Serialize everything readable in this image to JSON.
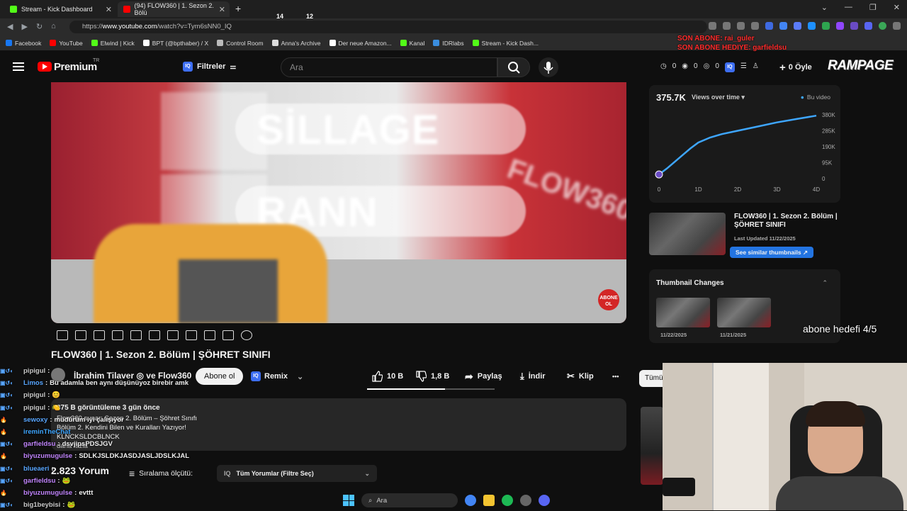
{
  "browser": {
    "tabs": [
      {
        "title": "Stream - Kick Dashboard",
        "color": "#53fc18"
      },
      {
        "title": "(94) FLOW360 | 1. Sezon 2. Bölü",
        "color": "#ff0000"
      }
    ],
    "trophies": [
      "14",
      "12"
    ],
    "url_prefix": "https://",
    "url_domain": "www.youtube.com",
    "url_path": "/watch?v=Tym6sNN0_IQ",
    "bookmarks": [
      {
        "label": "Facebook",
        "color": "#1877f2"
      },
      {
        "label": "YouTube",
        "color": "#ff0000"
      },
      {
        "label": "Elwind | Kick",
        "color": "#53fc18"
      },
      {
        "label": "BPT (@bpthaber) / X",
        "color": "#ffffff"
      },
      {
        "label": "Control Room",
        "color": "#bbbbbb"
      },
      {
        "label": "Anna's Archive",
        "color": "#dddddd"
      },
      {
        "label": "Der neue Amazon...",
        "color": "#ffffff"
      },
      {
        "label": "Kanal",
        "color": "#53fc18"
      },
      {
        "label": "IDRlabs",
        "color": "#3a8dde"
      },
      {
        "label": "Stream - Kick Dash...",
        "color": "#53fc18"
      }
    ]
  },
  "overlay": {
    "son_abone": "SON ABONE: rai_guler",
    "son_hediye": "SON ABONE HEDIYE: garfieldsu",
    "brand": "RAMPAGE",
    "abone_hedefi": "abone hedefi 4/5"
  },
  "header": {
    "premium": "Premium",
    "region": "TR",
    "filters": "Filtreler",
    "search_placeholder": "Ara",
    "counters": [
      "0",
      "0",
      "0"
    ],
    "create_label": "0 Öyle"
  },
  "video": {
    "overlay_name1": "SİLLAGE",
    "overlay_name2": "RANN",
    "watermark": "FLOW360",
    "subscribe_badge_line1": "ABONE",
    "subscribe_badge_line2": "OL",
    "title": "FLOW360 | 1. Sezon 2. Bölüm | ŞÖHRET SINIFI"
  },
  "channel": {
    "name": "İbrahim Tilaver ◎ ve Flow360",
    "subscribe": "Abone ol",
    "remix": "Remix",
    "likes": "10 B",
    "dislikes": "1,8 B",
    "share": "Paylaş",
    "download": "İndir",
    "clip": "Klip",
    "more": "•••"
  },
  "description": {
    "stats": "375 B görüntüleme  3 gün önce",
    "line1": "Flow360 sunar: Sezon 2. Bölüm – Şöhret Sınıfı",
    "line2": "Bölüm 2. Kendini Bilen ve Kuralları Yazıyor!",
    "line3": "KLNCKSLDCBLNCK",
    "line4": "daha fazla"
  },
  "comments": {
    "count": "2.823 Yorum",
    "sort": "Sıralama ölçütü:",
    "filter": "Tüm Yorumlar (Filtre Seç)"
  },
  "chat": [
    {
      "user": "pipigul",
      "msg": "",
      "color": "#c9c9c9"
    },
    {
      "user": "Limos",
      "msg": "Bu adamla ben aynı düşünüyoz birebir amk",
      "color": "#58a6ff"
    },
    {
      "user": "pipigul",
      "msg": "😊",
      "color": "#c9c9c9"
    },
    {
      "user": "pipigul",
      "msg": "🍋",
      "color": "#c9c9c9"
    },
    {
      "user": "sewoxy",
      "msg": "müdürüm iyi çalışıyor",
      "color": "#58a6ff"
    },
    {
      "user": "ireminTheChat",
      "msg": "",
      "color": "#3ea6ff"
    },
    {
      "user": "garfieldsu",
      "msg": "dsvjipsPDSJGV",
      "color": "#c084fc"
    },
    {
      "user": "biyuzumugulse",
      "msg": "SDLKJSLDKJASDJASLJDSLKJAL",
      "color": "#c084fc"
    },
    {
      "user": "blueaeri",
      "msg": "",
      "color": "#58a6ff"
    },
    {
      "user": "garfieldsu",
      "msg": "🐸",
      "color": "#c084fc"
    },
    {
      "user": "biyuzumugulse",
      "msg": "evttt",
      "color": "#c084fc"
    },
    {
      "user": "big1beybisi",
      "msg": "🐸",
      "color": "#c9c9c9"
    }
  ],
  "analytics": {
    "views": "375.7K",
    "views_label": "Views over time",
    "legend": "Bu video",
    "y_ticks": [
      "380K",
      "285K",
      "190K",
      "95K",
      "0"
    ],
    "x_ticks": [
      "0",
      "1D",
      "2D",
      "3D",
      "4D"
    ]
  },
  "chart_data": {
    "type": "line",
    "title": "",
    "xlabel": "",
    "ylabel": "",
    "x": [
      0,
      0.2,
      0.4,
      0.6,
      0.8,
      1.0,
      1.3,
      1.6,
      2.0,
      2.5,
      3.0,
      3.5,
      4.0
    ],
    "series": [
      {
        "name": "Bu video",
        "values": [
          25,
          60,
          100,
          140,
          180,
          215,
          245,
          265,
          285,
          310,
          335,
          355,
          375
        ],
        "color": "#3ea6ff"
      }
    ],
    "xlim": [
      0,
      4
    ],
    "ylim": [
      0,
      380
    ],
    "grid": false,
    "legend": "top-right"
  },
  "similar": {
    "title": "FLOW360 | 1. Sezon 2. Bölüm | ŞÖHRET SINIFI",
    "updated": "Last Updated 11/22/2025",
    "button": "See similar thumbnails ↗"
  },
  "thumbnail_changes": {
    "title": "Thumbnail Changes",
    "dates": [
      "11/22/2025",
      "11/21/2025"
    ]
  },
  "sidebar": {
    "chip": "Tümü"
  },
  "taskbar": {
    "search": "Ara"
  }
}
